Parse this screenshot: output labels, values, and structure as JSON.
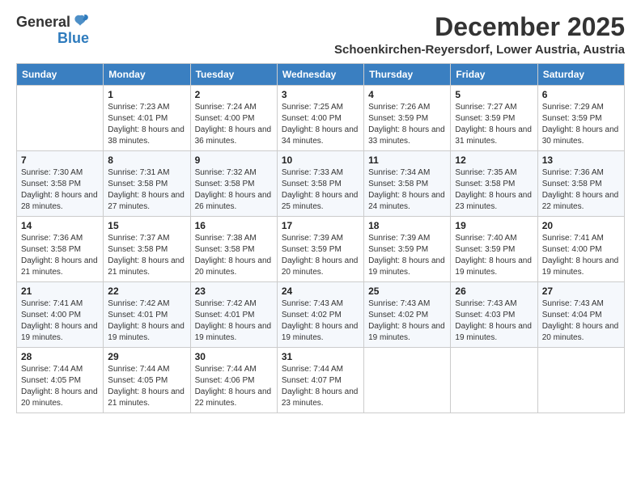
{
  "logo": {
    "general": "General",
    "blue": "Blue"
  },
  "header": {
    "month": "December 2025",
    "location": "Schoenkirchen-Reyersdorf, Lower Austria, Austria"
  },
  "weekdays": [
    "Sunday",
    "Monday",
    "Tuesday",
    "Wednesday",
    "Thursday",
    "Friday",
    "Saturday"
  ],
  "weeks": [
    [
      {
        "day": "",
        "sunrise": "",
        "sunset": "",
        "daylight": ""
      },
      {
        "day": "1",
        "sunrise": "Sunrise: 7:23 AM",
        "sunset": "Sunset: 4:01 PM",
        "daylight": "Daylight: 8 hours and 38 minutes."
      },
      {
        "day": "2",
        "sunrise": "Sunrise: 7:24 AM",
        "sunset": "Sunset: 4:00 PM",
        "daylight": "Daylight: 8 hours and 36 minutes."
      },
      {
        "day": "3",
        "sunrise": "Sunrise: 7:25 AM",
        "sunset": "Sunset: 4:00 PM",
        "daylight": "Daylight: 8 hours and 34 minutes."
      },
      {
        "day": "4",
        "sunrise": "Sunrise: 7:26 AM",
        "sunset": "Sunset: 3:59 PM",
        "daylight": "Daylight: 8 hours and 33 minutes."
      },
      {
        "day": "5",
        "sunrise": "Sunrise: 7:27 AM",
        "sunset": "Sunset: 3:59 PM",
        "daylight": "Daylight: 8 hours and 31 minutes."
      },
      {
        "day": "6",
        "sunrise": "Sunrise: 7:29 AM",
        "sunset": "Sunset: 3:59 PM",
        "daylight": "Daylight: 8 hours and 30 minutes."
      }
    ],
    [
      {
        "day": "7",
        "sunrise": "Sunrise: 7:30 AM",
        "sunset": "Sunset: 3:58 PM",
        "daylight": "Daylight: 8 hours and 28 minutes."
      },
      {
        "day": "8",
        "sunrise": "Sunrise: 7:31 AM",
        "sunset": "Sunset: 3:58 PM",
        "daylight": "Daylight: 8 hours and 27 minutes."
      },
      {
        "day": "9",
        "sunrise": "Sunrise: 7:32 AM",
        "sunset": "Sunset: 3:58 PM",
        "daylight": "Daylight: 8 hours and 26 minutes."
      },
      {
        "day": "10",
        "sunrise": "Sunrise: 7:33 AM",
        "sunset": "Sunset: 3:58 PM",
        "daylight": "Daylight: 8 hours and 25 minutes."
      },
      {
        "day": "11",
        "sunrise": "Sunrise: 7:34 AM",
        "sunset": "Sunset: 3:58 PM",
        "daylight": "Daylight: 8 hours and 24 minutes."
      },
      {
        "day": "12",
        "sunrise": "Sunrise: 7:35 AM",
        "sunset": "Sunset: 3:58 PM",
        "daylight": "Daylight: 8 hours and 23 minutes."
      },
      {
        "day": "13",
        "sunrise": "Sunrise: 7:36 AM",
        "sunset": "Sunset: 3:58 PM",
        "daylight": "Daylight: 8 hours and 22 minutes."
      }
    ],
    [
      {
        "day": "14",
        "sunrise": "Sunrise: 7:36 AM",
        "sunset": "Sunset: 3:58 PM",
        "daylight": "Daylight: 8 hours and 21 minutes."
      },
      {
        "day": "15",
        "sunrise": "Sunrise: 7:37 AM",
        "sunset": "Sunset: 3:58 PM",
        "daylight": "Daylight: 8 hours and 21 minutes."
      },
      {
        "day": "16",
        "sunrise": "Sunrise: 7:38 AM",
        "sunset": "Sunset: 3:58 PM",
        "daylight": "Daylight: 8 hours and 20 minutes."
      },
      {
        "day": "17",
        "sunrise": "Sunrise: 7:39 AM",
        "sunset": "Sunset: 3:59 PM",
        "daylight": "Daylight: 8 hours and 20 minutes."
      },
      {
        "day": "18",
        "sunrise": "Sunrise: 7:39 AM",
        "sunset": "Sunset: 3:59 PM",
        "daylight": "Daylight: 8 hours and 19 minutes."
      },
      {
        "day": "19",
        "sunrise": "Sunrise: 7:40 AM",
        "sunset": "Sunset: 3:59 PM",
        "daylight": "Daylight: 8 hours and 19 minutes."
      },
      {
        "day": "20",
        "sunrise": "Sunrise: 7:41 AM",
        "sunset": "Sunset: 4:00 PM",
        "daylight": "Daylight: 8 hours and 19 minutes."
      }
    ],
    [
      {
        "day": "21",
        "sunrise": "Sunrise: 7:41 AM",
        "sunset": "Sunset: 4:00 PM",
        "daylight": "Daylight: 8 hours and 19 minutes."
      },
      {
        "day": "22",
        "sunrise": "Sunrise: 7:42 AM",
        "sunset": "Sunset: 4:01 PM",
        "daylight": "Daylight: 8 hours and 19 minutes."
      },
      {
        "day": "23",
        "sunrise": "Sunrise: 7:42 AM",
        "sunset": "Sunset: 4:01 PM",
        "daylight": "Daylight: 8 hours and 19 minutes."
      },
      {
        "day": "24",
        "sunrise": "Sunrise: 7:43 AM",
        "sunset": "Sunset: 4:02 PM",
        "daylight": "Daylight: 8 hours and 19 minutes."
      },
      {
        "day": "25",
        "sunrise": "Sunrise: 7:43 AM",
        "sunset": "Sunset: 4:02 PM",
        "daylight": "Daylight: 8 hours and 19 minutes."
      },
      {
        "day": "26",
        "sunrise": "Sunrise: 7:43 AM",
        "sunset": "Sunset: 4:03 PM",
        "daylight": "Daylight: 8 hours and 19 minutes."
      },
      {
        "day": "27",
        "sunrise": "Sunrise: 7:43 AM",
        "sunset": "Sunset: 4:04 PM",
        "daylight": "Daylight: 8 hours and 20 minutes."
      }
    ],
    [
      {
        "day": "28",
        "sunrise": "Sunrise: 7:44 AM",
        "sunset": "Sunset: 4:05 PM",
        "daylight": "Daylight: 8 hours and 20 minutes."
      },
      {
        "day": "29",
        "sunrise": "Sunrise: 7:44 AM",
        "sunset": "Sunset: 4:05 PM",
        "daylight": "Daylight: 8 hours and 21 minutes."
      },
      {
        "day": "30",
        "sunrise": "Sunrise: 7:44 AM",
        "sunset": "Sunset: 4:06 PM",
        "daylight": "Daylight: 8 hours and 22 minutes."
      },
      {
        "day": "31",
        "sunrise": "Sunrise: 7:44 AM",
        "sunset": "Sunset: 4:07 PM",
        "daylight": "Daylight: 8 hours and 23 minutes."
      },
      {
        "day": "",
        "sunrise": "",
        "sunset": "",
        "daylight": ""
      },
      {
        "day": "",
        "sunrise": "",
        "sunset": "",
        "daylight": ""
      },
      {
        "day": "",
        "sunrise": "",
        "sunset": "",
        "daylight": ""
      }
    ]
  ]
}
